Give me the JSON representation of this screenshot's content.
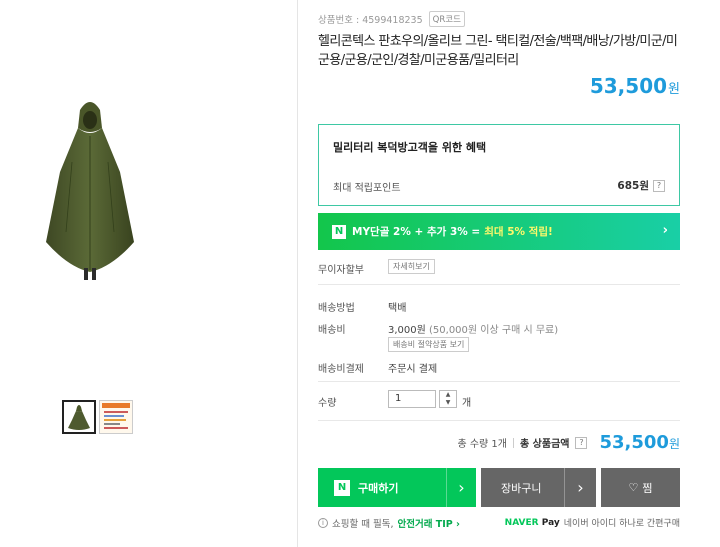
{
  "product": {
    "number_label": "상품번호 : 4599418235",
    "qr_label": "QR코드",
    "title": "헬리콘텍스 판쵸우의/올리브 그린- 택티컬/전술/백팩/배낭/가방/미군/미군용/군용/군인/경찰/미군용품/밀리터리",
    "price": "53,500",
    "price_unit": "원"
  },
  "benefit": {
    "title": "밀리터리 복덕방고객을 위한 혜택",
    "points_label": "최대 적립포인트",
    "points_value": "685원",
    "help": "?"
  },
  "naver_banner": {
    "logo": "N",
    "text": "MY단골 2% + 추가 3% =",
    "highlight": "최대 5% 적립!",
    "chevron": "›"
  },
  "installment": {
    "label": "무이자할부",
    "button": "자세히보기"
  },
  "shipping": {
    "method_label": "배송방법",
    "method_value": "택배",
    "fee_label": "배송비",
    "fee_value": "3,000원",
    "fee_note": "(50,000원 이상 구매 시 무료)",
    "fee_button": "배송비 절약상품 보기",
    "payment_label": "배송비결제",
    "payment_value": "주문시 결제"
  },
  "quantity": {
    "label": "수량",
    "value": "1",
    "up": "▲",
    "down": "▼",
    "unit": "개"
  },
  "total": {
    "qty_text": "총 수량 1개",
    "label": "총 상품금액",
    "help": "?",
    "price": "53,500",
    "unit": "원"
  },
  "actions": {
    "buy_logo": "N",
    "buy_label": "구매하기",
    "buy_chevron": "›",
    "cart_label": "장바구니",
    "cart_chevron": "›",
    "wish_icon": "♡",
    "wish_label": "찜"
  },
  "footer": {
    "info_icon": "i",
    "notice": "쇼핑할 때 필독,",
    "safe_link": "안전거래 TIP ›",
    "pay_brand_naver": "NAVER",
    "pay_brand_pay": "Pay",
    "pay_text": "네이버 아이디 하나로 간편구매"
  },
  "icons": {
    "thumbnail_1": "poncho-photo",
    "thumbnail_2": "detail-card-photo"
  },
  "colors": {
    "accent_price": "#1e9bdb",
    "naver_green": "#03c75a",
    "benefit_border": "#3ec8a4",
    "poncho_olive": "#4e5a2f"
  }
}
